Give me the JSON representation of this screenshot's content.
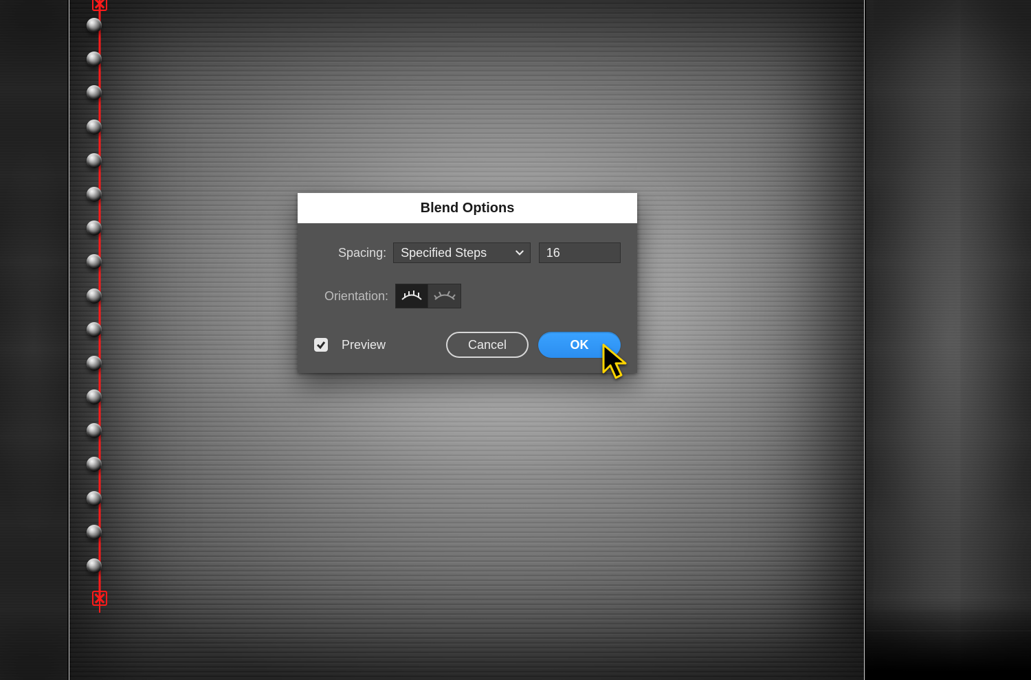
{
  "dialog": {
    "title": "Blend Options",
    "spacing_label": "Spacing:",
    "spacing_mode": "Specified Steps",
    "spacing_value": "16",
    "orientation_label": "Orientation:",
    "orientation_selected": "align-to-page",
    "preview_label": "Preview",
    "preview_checked": true,
    "cancel_label": "Cancel",
    "ok_label": "OK"
  },
  "canvas": {
    "rivet_count": 17
  },
  "colors": {
    "selection": "#ff1a1a",
    "accent": "#2b8ef0",
    "panel": "#535353"
  }
}
